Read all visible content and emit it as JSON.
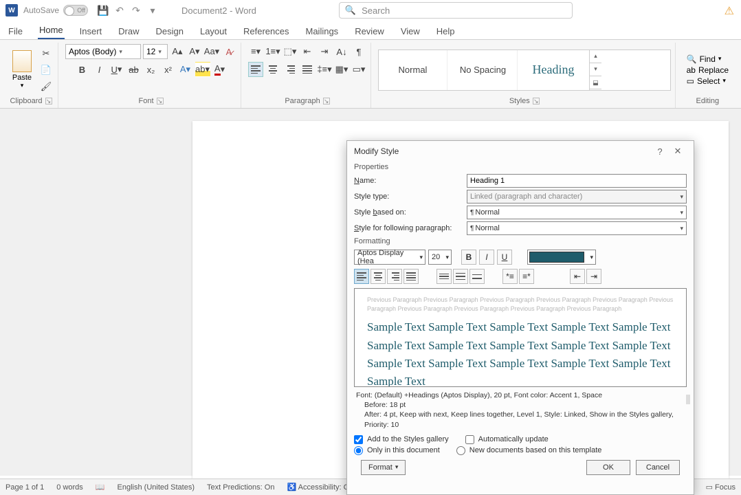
{
  "titlebar": {
    "autosave_label": "AutoSave",
    "autosave_state": "Off",
    "doc_title": "Document2 - Word",
    "search_placeholder": "Search"
  },
  "tabs": [
    "File",
    "Home",
    "Insert",
    "Draw",
    "Design",
    "Layout",
    "References",
    "Mailings",
    "Review",
    "View",
    "Help"
  ],
  "active_tab": "Home",
  "ribbon": {
    "clipboard": {
      "label": "Clipboard",
      "paste": "Paste"
    },
    "font": {
      "label": "Font",
      "name": "Aptos (Body)",
      "size": "12"
    },
    "paragraph": {
      "label": "Paragraph"
    },
    "styles": {
      "label": "Styles",
      "items": [
        "Normal",
        "No Spacing",
        "Heading"
      ]
    },
    "editing": {
      "label": "Editing",
      "find": "Find",
      "replace": "Replace",
      "select": "Select"
    }
  },
  "statusbar": {
    "page": "Page 1 of 1",
    "words": "0 words",
    "lang": "English (United States)",
    "pred": "Text Predictions: On",
    "access": "Accessibility: Go",
    "focus": "Focus"
  },
  "dialog": {
    "title": "Modify Style",
    "properties_label": "Properties",
    "name_label": "Name:",
    "name_value": "Heading 1",
    "type_label": "Style type:",
    "type_value": "Linked (paragraph and character)",
    "based_label": "Style based on:",
    "based_value": "Normal",
    "following_label": "Style for following paragraph:",
    "following_value": "Normal",
    "formatting_label": "Formatting",
    "font_name": "Aptos Display (Hea",
    "font_size": "20",
    "color": "#1f5c6b",
    "preview_prev": "Previous Paragraph Previous Paragraph Previous Paragraph Previous Paragraph Previous Paragraph Previous Paragraph Previous Paragraph Previous Paragraph Previous Paragraph Previous Paragraph",
    "preview_sample": "Sample Text Sample Text Sample Text Sample Text Sample Text Sample Text Sample Text Sample Text Sample Text Sample Text Sample Text Sample Text Sample Text Sample Text Sample Text Sample Text",
    "desc_line1": "Font: (Default) +Headings (Aptos Display), 20 pt, Font color: Accent 1, Space",
    "desc_line2": "Before:  18 pt",
    "desc_line3": "After:  4 pt, Keep with next, Keep lines together, Level 1, Style: Linked, Show in the Styles gallery, Priority: 10",
    "add_gallery": "Add to the Styles gallery",
    "auto_update": "Automatically update",
    "only_doc": "Only in this document",
    "new_docs": "New documents based on this template",
    "format_btn": "Format",
    "ok": "OK",
    "cancel": "Cancel"
  }
}
